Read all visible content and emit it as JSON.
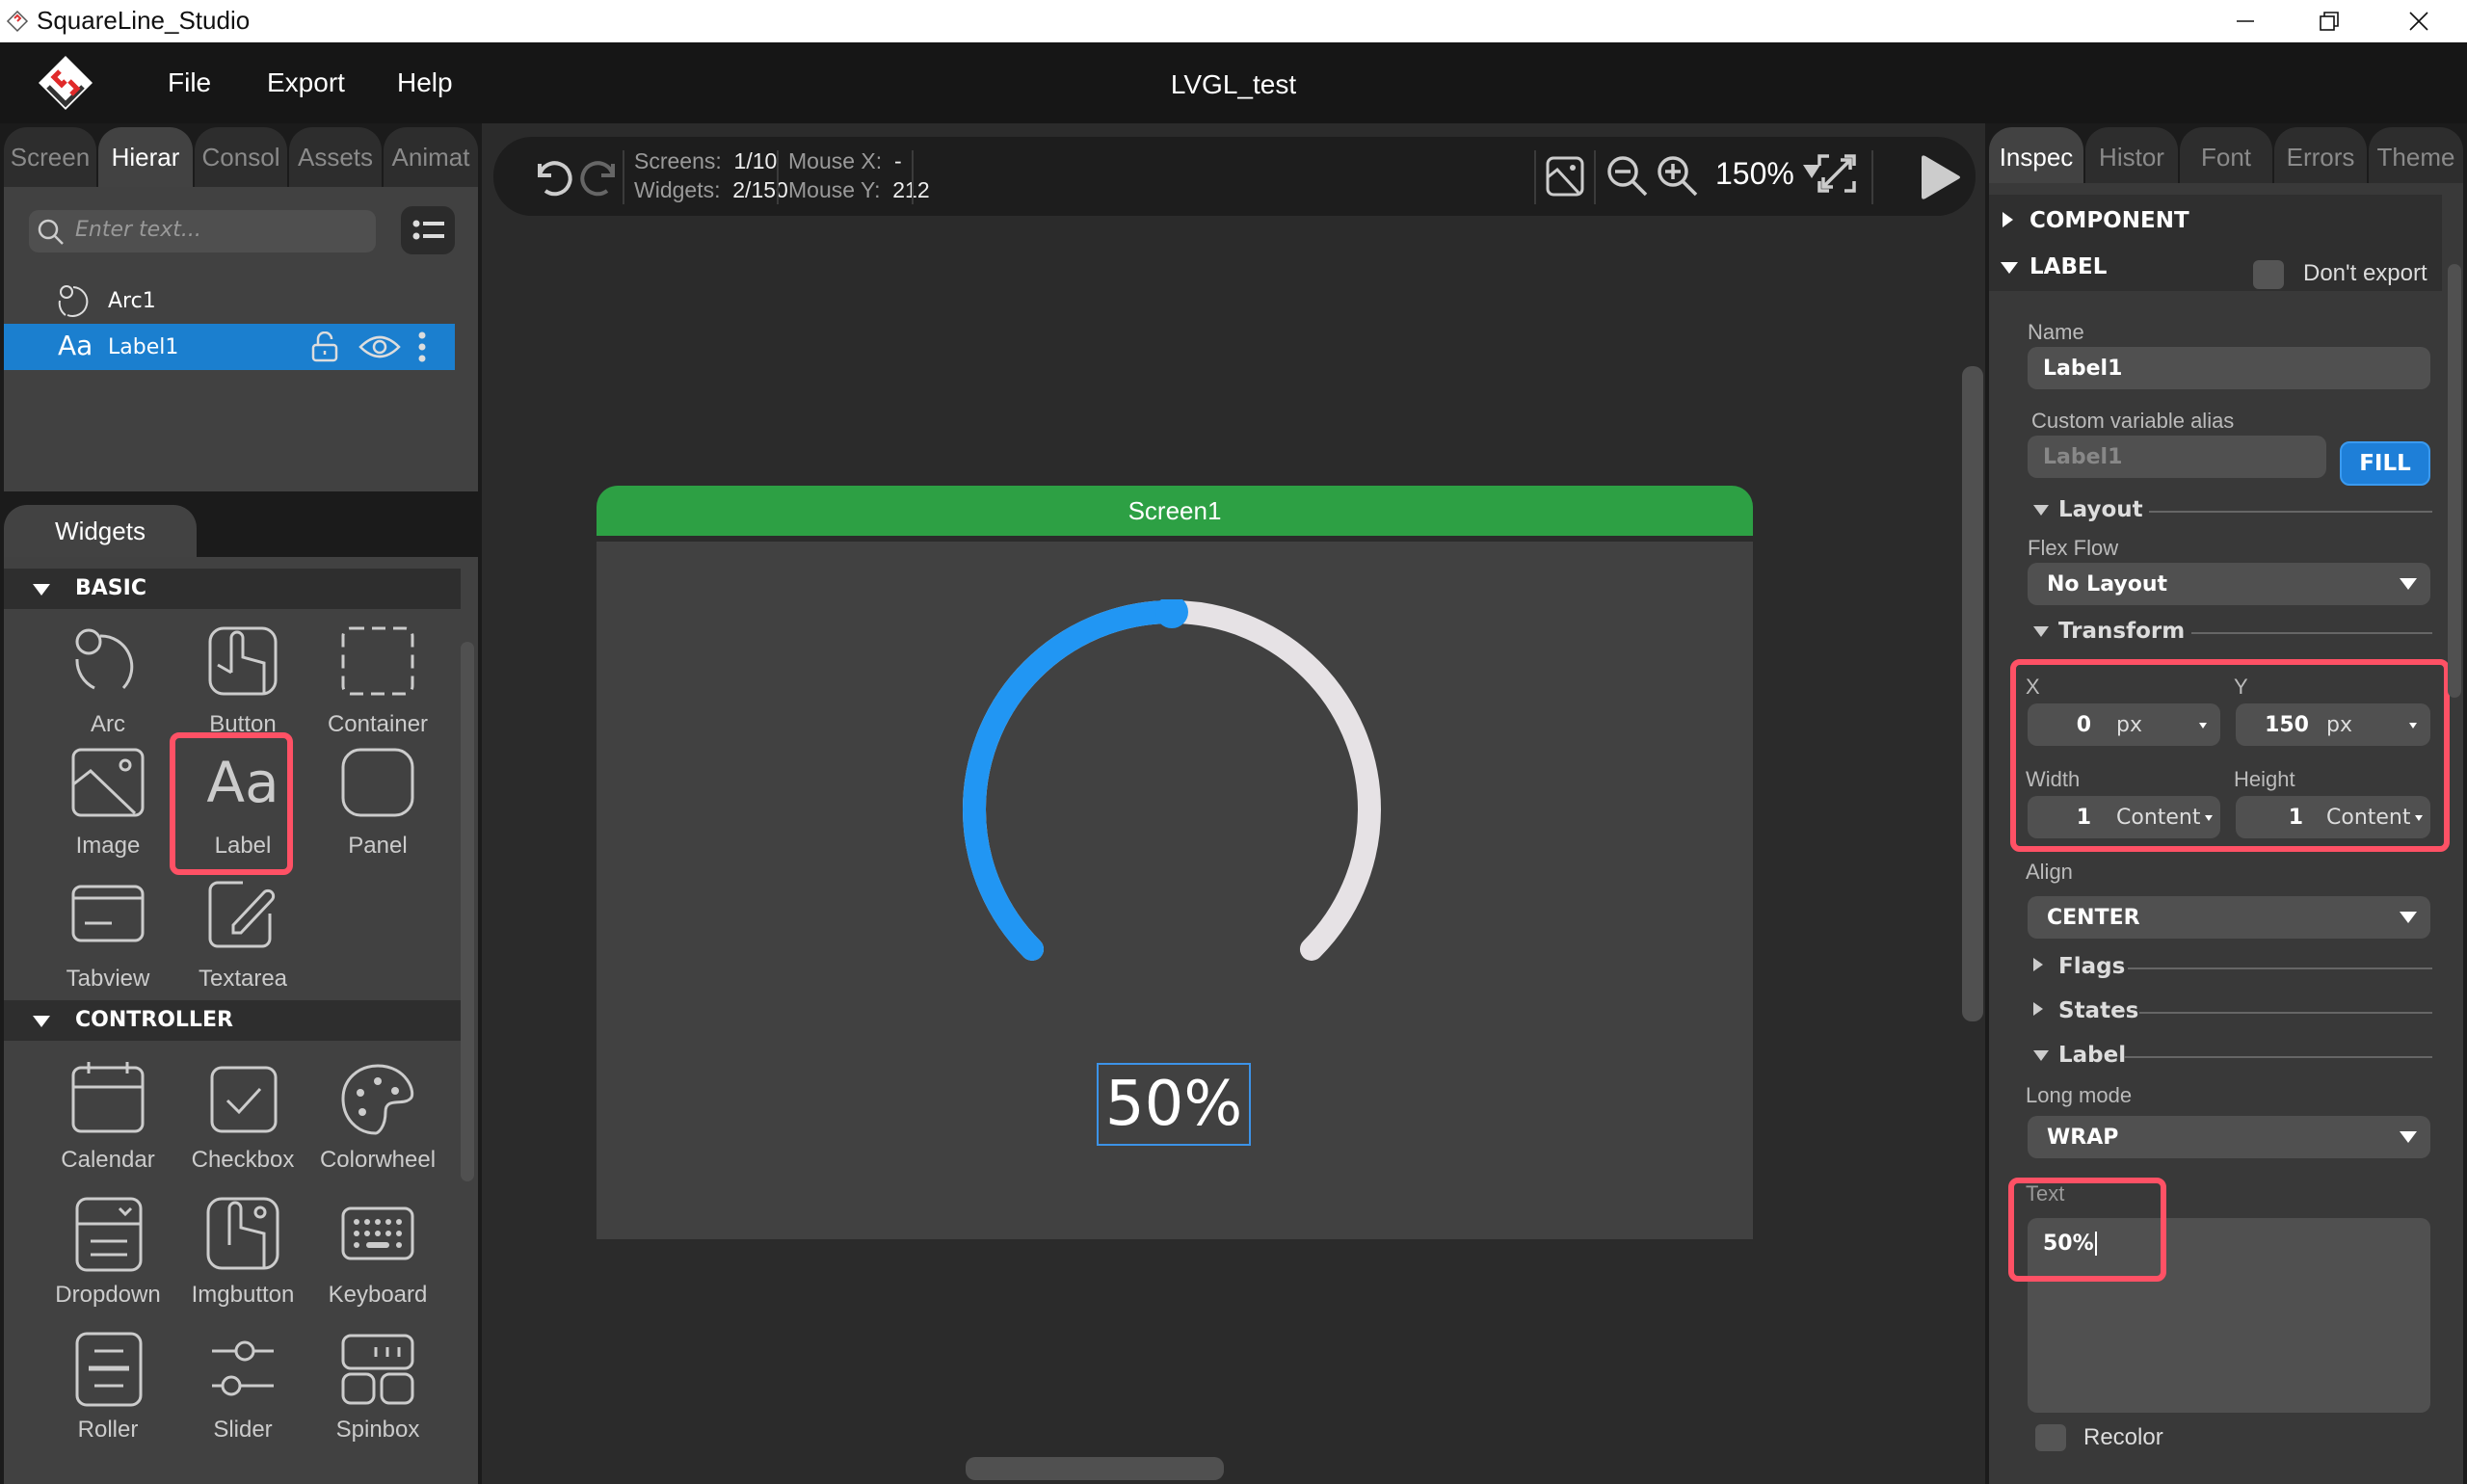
{
  "window": {
    "title": "SquareLine_Studio",
    "minimize": "minimize",
    "restore": "restore",
    "close": "close"
  },
  "menu": {
    "items": [
      "File",
      "Export",
      "Help"
    ],
    "project_title": "LVGL_test"
  },
  "left_tabs": [
    {
      "label": "Screen",
      "active": false
    },
    {
      "label": "Hierar",
      "active": true
    },
    {
      "label": "Consol",
      "active": false
    },
    {
      "label": "Assets",
      "active": false
    },
    {
      "label": "Animat",
      "active": false
    }
  ],
  "hierarchy": {
    "search_placeholder": "Enter text...",
    "items": [
      {
        "name": "Arc1",
        "icon": "arc-icon",
        "selected": false
      },
      {
        "name": "Label1",
        "icon": "label-icon",
        "selected": true
      }
    ]
  },
  "widgets_panel": {
    "tab": "Widgets",
    "sections": [
      {
        "title": "BASIC",
        "items": [
          "Arc",
          "Button",
          "Container",
          "Image",
          "Label",
          "Panel",
          "Tabview",
          "Textarea"
        ]
      },
      {
        "title": "CONTROLLER",
        "items": [
          "Calendar",
          "Checkbox",
          "Colorwheel",
          "Dropdown",
          "Imgbutton",
          "Keyboard",
          "Roller",
          "Slider",
          "Spinbox"
        ]
      }
    ],
    "highlighted": "Label"
  },
  "toolbar": {
    "screens_label": "Screens:",
    "screens_value": "1/10",
    "widgets_label": "Widgets:",
    "widgets_value": "2/150",
    "mouse_x_label": "Mouse X:",
    "mouse_x_value": "-",
    "mouse_y_label": "Mouse Y:",
    "mouse_y_value": "212",
    "zoom": "150%"
  },
  "canvas": {
    "screen_name": "Screen1",
    "arc": {
      "value_percent": 50,
      "indicator_color": "#2196f3",
      "background_color": "#e6e2e5"
    },
    "label_text": "50%",
    "header_color": "#2da044"
  },
  "right_tabs": [
    {
      "label": "Inspec",
      "active": true
    },
    {
      "label": "Histor",
      "active": false
    },
    {
      "label": "Font",
      "active": false
    },
    {
      "label": "Errors",
      "active": false
    },
    {
      "label": "Theme",
      "active": false
    }
  ],
  "inspector": {
    "component_title": "COMPONENT",
    "label_title": "LABEL",
    "dont_export": "Don't export",
    "name_label": "Name",
    "name_value": "Label1",
    "alias_label": "Custom variable alias",
    "alias_placeholder": "Label1",
    "fill_button": "FILL",
    "layout_title": "Layout",
    "flex_flow_label": "Flex Flow",
    "flex_flow_value": "No Layout",
    "transform_title": "Transform",
    "x_label": "X",
    "x_value": "0",
    "x_unit": "px",
    "y_label": "Y",
    "y_value": "150",
    "y_unit": "px",
    "width_label": "Width",
    "width_value": "1",
    "width_unit": "Content",
    "height_label": "Height",
    "height_value": "1",
    "height_unit": "Content",
    "align_label": "Align",
    "align_value": "CENTER",
    "flags_title": "Flags",
    "states_title": "States",
    "label_section_title": "Label",
    "long_mode_label": "Long mode",
    "long_mode_value": "WRAP",
    "text_label": "Text",
    "text_value": "50%",
    "recolor_label": "Recolor"
  },
  "accent": {
    "selection_blue": "#1b7fcf",
    "highlight_red": "#ff5165",
    "fill_button_blue": "#1e7fd8"
  }
}
